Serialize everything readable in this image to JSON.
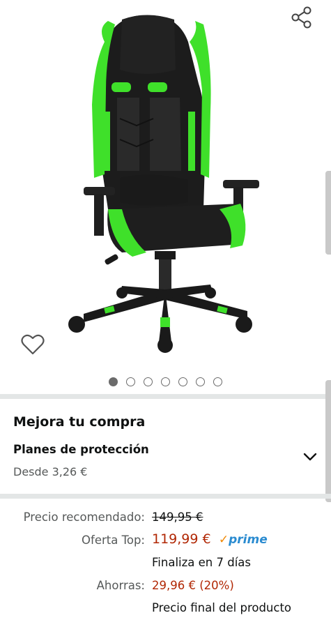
{
  "product": {
    "image_name": "gaming-chair-black-green",
    "gallery_count": 7,
    "gallery_active_index": 0
  },
  "upgrade": {
    "title": "Mejora tu compra",
    "plan_title": "Planes de protección",
    "plan_price": "Desde 3,26 €"
  },
  "pricing": {
    "list_label": "Precio recomendado:",
    "list_price": "149,95 €",
    "deal_label": "Oferta Top:",
    "deal_price": "119,99 €",
    "prime_check": "✓",
    "prime_word": "prime",
    "deal_ends": "Finaliza en 7 días",
    "savings_label": "Ahorras:",
    "savings_value": "29,96 € (20%)",
    "final_price_note": "Precio final del producto"
  },
  "colors": {
    "deal_red": "#b12704",
    "prime_blue": "#2a8bd0",
    "prime_orange": "#f08804",
    "chair_green": "#3fe02a"
  }
}
